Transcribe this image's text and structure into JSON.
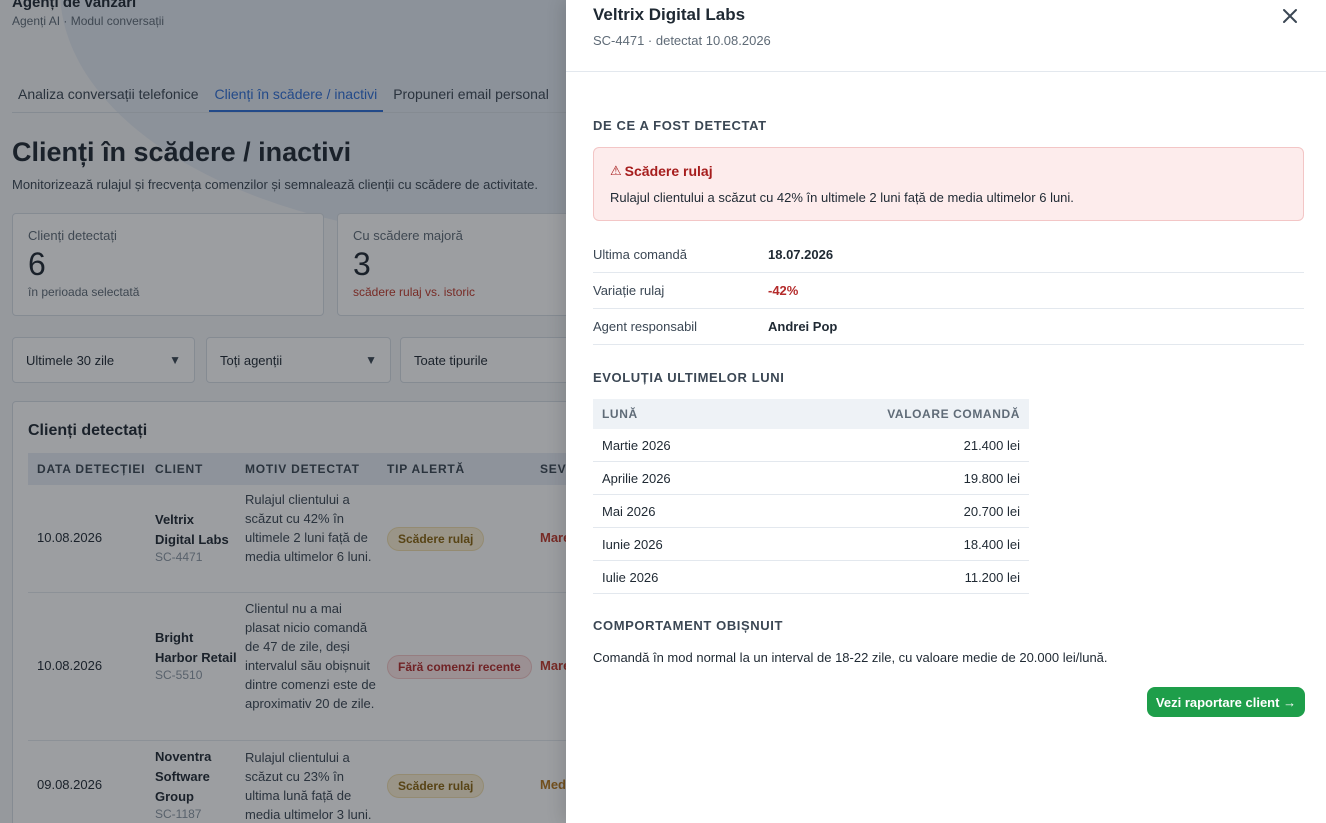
{
  "app": {
    "title": "Agenți de vânzări",
    "breadcrumb": "Agenți AI · Modul conversații"
  },
  "tabs": [
    {
      "label": "Analiza conversații telefonice",
      "active": false
    },
    {
      "label": "Clienți în scădere / inactivi",
      "active": true
    },
    {
      "label": "Propuneri email personal",
      "active": false
    }
  ],
  "page": {
    "title": "Clienți în scădere / inactivi",
    "description": "Monitorizează rulajul și frecvența comenzilor și semnalează clienții cu scădere de activitate."
  },
  "stats": [
    {
      "label": "Clienți detectați",
      "value": "6",
      "note": "în perioada selectată"
    },
    {
      "label": "Cu scădere majoră",
      "value": "3",
      "note": "scădere rulaj vs. istoric"
    }
  ],
  "filters": {
    "period": "Ultimele 30 zile",
    "agent": "Toți agenții",
    "type": "Toate tipurile"
  },
  "table": {
    "title": "Clienți detectați",
    "columns": [
      "DATA DETECȚIEI",
      "CLIENT",
      "MOTIV DETECTAT",
      "TIP ALERTĂ",
      "SEVE"
    ],
    "rows": [
      {
        "date": "10.08.2026",
        "client": "Veltrix Digital Labs",
        "code": "SC-4471",
        "reason": "Rulajul clientului a scăzut cu 42% în ultimele 2 luni față de media ultimelor 6 luni.",
        "alert": "Scădere rulaj",
        "severity": "Mare"
      },
      {
        "date": "10.08.2026",
        "client": "Bright Harbor Retail",
        "code": "SC-5510",
        "reason": "Clientul nu a mai plasat nicio comandă de 47 de zile, deși intervalul său obișnuit dintre comenzi este de aproximativ 20 de zile.",
        "alert": "Fără comenzi recente",
        "severity": "Mare"
      },
      {
        "date": "09.08.2026",
        "client": "Noventra Software Group",
        "code": "SC-1187",
        "reason": "Rulajul clientului a scăzut cu 23% în ultima lună față de media ultimelor 3 luni.",
        "alert": "Scădere rulaj",
        "severity": "Med"
      }
    ]
  },
  "drawer": {
    "title": "Veltrix Digital Labs",
    "subtitle": "SC-4471 · detectat 10.08.2026",
    "why_heading": "DE CE A FOST DETECTAT",
    "alert": {
      "icon": "warning-icon",
      "title": "Scădere rulaj",
      "text": "Rulajul clientului a scăzut cu 42% în ultimele 2 luni față de media ultimelor 6 luni."
    },
    "details": [
      {
        "label": "Ultima comandă",
        "value": "18.07.2026"
      },
      {
        "label": "Variație rulaj",
        "value": "-42%"
      },
      {
        "label": "Agent responsabil",
        "value": "Andrei Pop"
      }
    ],
    "evolution_heading": "EVOLUȚIA ULTIMELOR LUNI",
    "evolution": {
      "col_month": "LUNĂ",
      "col_value": "VALOARE COMANDĂ",
      "rows": [
        {
          "month": "Martie 2026",
          "value": "21.400 lei"
        },
        {
          "month": "Aprilie 2026",
          "value": "19.800 lei"
        },
        {
          "month": "Mai 2026",
          "value": "20.700 lei"
        },
        {
          "month": "Iunie 2026",
          "value": "18.400 lei"
        },
        {
          "month": "Iulie 2026",
          "value": "11.200 lei"
        }
      ]
    },
    "behavior_heading": "COMPORTAMENT OBIȘNUIT",
    "behavior_text": "Comandă în mod normal la un interval de 18-22 zile, cu valoare medie de 20.000 lei/lună.",
    "cta": "Vezi raportare client →"
  },
  "colors": {
    "accent": "#2f6fd6",
    "danger": "#b42b2b",
    "success": "#1e9e4a"
  }
}
